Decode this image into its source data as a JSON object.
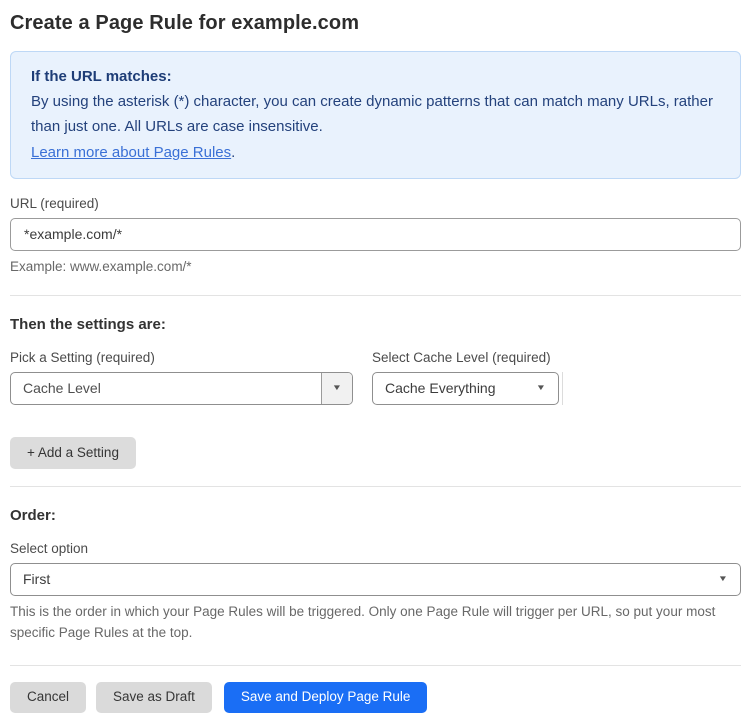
{
  "page": {
    "title": "Create a Page Rule for example.com"
  },
  "info_box": {
    "heading": "If the URL matches:",
    "body": "By using the asterisk (*) character, you can create dynamic patterns that can match many URLs, rather than just one. All URLs are case insensitive.",
    "link_label": "Learn more about Page Rules",
    "link_suffix": "."
  },
  "url_field": {
    "label": "URL (required)",
    "value": "*example.com/*",
    "helper": "Example: www.example.com/*"
  },
  "settings_section": {
    "heading": "Then the settings are:",
    "setting_select": {
      "label": "Pick a Setting (required)",
      "value": "Cache Level"
    },
    "cache_level_select": {
      "label": "Select Cache Level (required)",
      "value": "Cache Everything"
    },
    "add_setting_label": "+ Add a Setting"
  },
  "order_section": {
    "heading": "Order:",
    "label": "Select option",
    "value": "First",
    "helper": "This is the order in which your Page Rules will be triggered. Only one Page Rule will trigger per URL, so put your most specific Page Rules at the top."
  },
  "actions": {
    "cancel_label": "Cancel",
    "save_draft_label": "Save as Draft",
    "save_deploy_label": "Save and Deploy Page Rule"
  },
  "icons": {
    "dropdown_arrow": "▼"
  },
  "colors": {
    "info_bg": "#e9f2fd",
    "info_border": "#bed8f6",
    "info_text": "#24427c",
    "link": "#3a70d6",
    "primary_button": "#1a6ef5"
  }
}
